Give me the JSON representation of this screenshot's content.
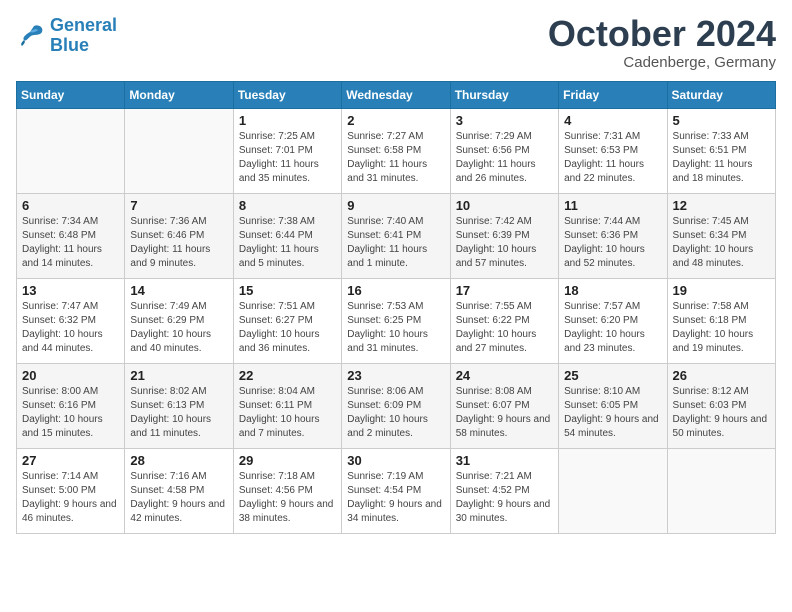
{
  "header": {
    "logo_line1": "General",
    "logo_line2": "Blue",
    "month_year": "October 2024",
    "location": "Cadenberge, Germany"
  },
  "days_of_week": [
    "Sunday",
    "Monday",
    "Tuesday",
    "Wednesday",
    "Thursday",
    "Friday",
    "Saturday"
  ],
  "weeks": [
    [
      {
        "day": "",
        "info": ""
      },
      {
        "day": "",
        "info": ""
      },
      {
        "day": "1",
        "info": "Sunrise: 7:25 AM\nSunset: 7:01 PM\nDaylight: 11 hours and 35 minutes."
      },
      {
        "day": "2",
        "info": "Sunrise: 7:27 AM\nSunset: 6:58 PM\nDaylight: 11 hours and 31 minutes."
      },
      {
        "day": "3",
        "info": "Sunrise: 7:29 AM\nSunset: 6:56 PM\nDaylight: 11 hours and 26 minutes."
      },
      {
        "day": "4",
        "info": "Sunrise: 7:31 AM\nSunset: 6:53 PM\nDaylight: 11 hours and 22 minutes."
      },
      {
        "day": "5",
        "info": "Sunrise: 7:33 AM\nSunset: 6:51 PM\nDaylight: 11 hours and 18 minutes."
      }
    ],
    [
      {
        "day": "6",
        "info": "Sunrise: 7:34 AM\nSunset: 6:48 PM\nDaylight: 11 hours and 14 minutes."
      },
      {
        "day": "7",
        "info": "Sunrise: 7:36 AM\nSunset: 6:46 PM\nDaylight: 11 hours and 9 minutes."
      },
      {
        "day": "8",
        "info": "Sunrise: 7:38 AM\nSunset: 6:44 PM\nDaylight: 11 hours and 5 minutes."
      },
      {
        "day": "9",
        "info": "Sunrise: 7:40 AM\nSunset: 6:41 PM\nDaylight: 11 hours and 1 minute."
      },
      {
        "day": "10",
        "info": "Sunrise: 7:42 AM\nSunset: 6:39 PM\nDaylight: 10 hours and 57 minutes."
      },
      {
        "day": "11",
        "info": "Sunrise: 7:44 AM\nSunset: 6:36 PM\nDaylight: 10 hours and 52 minutes."
      },
      {
        "day": "12",
        "info": "Sunrise: 7:45 AM\nSunset: 6:34 PM\nDaylight: 10 hours and 48 minutes."
      }
    ],
    [
      {
        "day": "13",
        "info": "Sunrise: 7:47 AM\nSunset: 6:32 PM\nDaylight: 10 hours and 44 minutes."
      },
      {
        "day": "14",
        "info": "Sunrise: 7:49 AM\nSunset: 6:29 PM\nDaylight: 10 hours and 40 minutes."
      },
      {
        "day": "15",
        "info": "Sunrise: 7:51 AM\nSunset: 6:27 PM\nDaylight: 10 hours and 36 minutes."
      },
      {
        "day": "16",
        "info": "Sunrise: 7:53 AM\nSunset: 6:25 PM\nDaylight: 10 hours and 31 minutes."
      },
      {
        "day": "17",
        "info": "Sunrise: 7:55 AM\nSunset: 6:22 PM\nDaylight: 10 hours and 27 minutes."
      },
      {
        "day": "18",
        "info": "Sunrise: 7:57 AM\nSunset: 6:20 PM\nDaylight: 10 hours and 23 minutes."
      },
      {
        "day": "19",
        "info": "Sunrise: 7:58 AM\nSunset: 6:18 PM\nDaylight: 10 hours and 19 minutes."
      }
    ],
    [
      {
        "day": "20",
        "info": "Sunrise: 8:00 AM\nSunset: 6:16 PM\nDaylight: 10 hours and 15 minutes."
      },
      {
        "day": "21",
        "info": "Sunrise: 8:02 AM\nSunset: 6:13 PM\nDaylight: 10 hours and 11 minutes."
      },
      {
        "day": "22",
        "info": "Sunrise: 8:04 AM\nSunset: 6:11 PM\nDaylight: 10 hours and 7 minutes."
      },
      {
        "day": "23",
        "info": "Sunrise: 8:06 AM\nSunset: 6:09 PM\nDaylight: 10 hours and 2 minutes."
      },
      {
        "day": "24",
        "info": "Sunrise: 8:08 AM\nSunset: 6:07 PM\nDaylight: 9 hours and 58 minutes."
      },
      {
        "day": "25",
        "info": "Sunrise: 8:10 AM\nSunset: 6:05 PM\nDaylight: 9 hours and 54 minutes."
      },
      {
        "day": "26",
        "info": "Sunrise: 8:12 AM\nSunset: 6:03 PM\nDaylight: 9 hours and 50 minutes."
      }
    ],
    [
      {
        "day": "27",
        "info": "Sunrise: 7:14 AM\nSunset: 5:00 PM\nDaylight: 9 hours and 46 minutes."
      },
      {
        "day": "28",
        "info": "Sunrise: 7:16 AM\nSunset: 4:58 PM\nDaylight: 9 hours and 42 minutes."
      },
      {
        "day": "29",
        "info": "Sunrise: 7:18 AM\nSunset: 4:56 PM\nDaylight: 9 hours and 38 minutes."
      },
      {
        "day": "30",
        "info": "Sunrise: 7:19 AM\nSunset: 4:54 PM\nDaylight: 9 hours and 34 minutes."
      },
      {
        "day": "31",
        "info": "Sunrise: 7:21 AM\nSunset: 4:52 PM\nDaylight: 9 hours and 30 minutes."
      },
      {
        "day": "",
        "info": ""
      },
      {
        "day": "",
        "info": ""
      }
    ]
  ]
}
